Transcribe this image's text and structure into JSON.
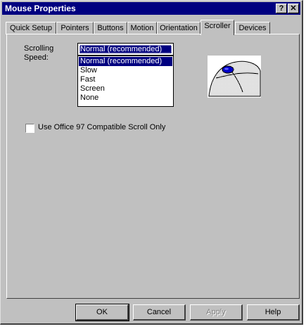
{
  "window": {
    "title": "Mouse Properties",
    "help_glyph": "?",
    "close_glyph": "✕"
  },
  "tabs": [
    {
      "label": "Quick Setup"
    },
    {
      "label": "Pointers"
    },
    {
      "label": "Buttons"
    },
    {
      "label": "Motion"
    },
    {
      "label": "Orientation"
    },
    {
      "label": "Scroller",
      "active": true
    },
    {
      "label": "Devices"
    }
  ],
  "scroller": {
    "speed_label_1": "Scrolling",
    "speed_label_2": "Speed:",
    "speed_value": "Normal (recommended)",
    "options": [
      "Normal (recommended)",
      "Slow",
      "Fast",
      "Screen",
      "None"
    ],
    "office97_label": "Use Office 97 Compatible Scroll Only",
    "office97_checked": false
  },
  "buttons": {
    "ok": "OK",
    "cancel": "Cancel",
    "apply": "Apply",
    "help": "Help"
  },
  "colors": {
    "accent": "#000080",
    "face": "#c0c0c0"
  }
}
